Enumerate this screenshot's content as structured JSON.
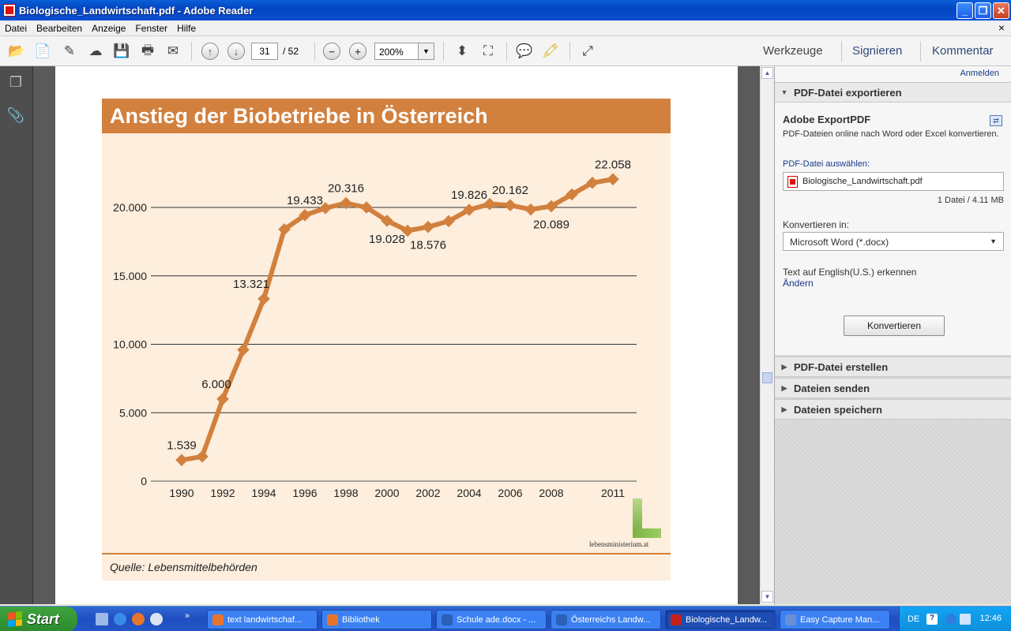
{
  "window": {
    "title": "Biologische_Landwirtschaft.pdf - Adobe Reader"
  },
  "menu": {
    "items": [
      "Datei",
      "Bearbeiten",
      "Anzeige",
      "Fenster",
      "Hilfe"
    ]
  },
  "toolbar": {
    "page_current": "31",
    "page_total": "/ 52",
    "zoom": "200%",
    "tools_label": "Werkzeuge",
    "sign_label": "Signieren",
    "comment_label": "Kommentar"
  },
  "document": {
    "chart_title": "Anstieg der Biobetriebe in Österreich",
    "source": "Quelle: Lebensmittelbehörden",
    "logo_text": "lebensministerium.at"
  },
  "chart_data": {
    "type": "line",
    "title": "Anstieg der Biobetriebe in Österreich",
    "xlabel": "",
    "ylabel": "",
    "ylim": [
      0,
      20000
    ],
    "yticks": [
      "0",
      "5.000",
      "10.000",
      "15.000",
      "20.000"
    ],
    "ytick_values": [
      0,
      5000,
      10000,
      15000,
      20000
    ],
    "xtick_labels": [
      "1990",
      "1992",
      "1994",
      "1996",
      "1998",
      "2000",
      "2002",
      "2004",
      "2006",
      "2008",
      "2011"
    ],
    "xtick_years": [
      1990,
      1992,
      1994,
      1996,
      1998,
      2000,
      2002,
      2004,
      2006,
      2008,
      2011
    ],
    "grid": true,
    "line_color": "#d2803d",
    "series": [
      {
        "x": [
          1990,
          1991,
          1992,
          1993,
          1994,
          1995,
          1996,
          1997,
          1998,
          1999,
          2000,
          2001,
          2002,
          2003,
          2004,
          2005,
          2006,
          2007,
          2008,
          2009,
          2010,
          2011
        ],
        "values": [
          1539,
          1800,
          6000,
          9600,
          13321,
          18400,
          19433,
          19950,
          20316,
          20000,
          19028,
          18300,
          18576,
          19000,
          19826,
          20250,
          20162,
          19850,
          20089,
          20950,
          21800,
          22058
        ]
      }
    ],
    "data_labels": [
      {
        "x": 1990,
        "text": "1.539"
      },
      {
        "x": 1992,
        "text": "6.000"
      },
      {
        "x": 1994,
        "text": "13.321"
      },
      {
        "x": 1996,
        "text": "19.433"
      },
      {
        "x": 1998,
        "text": "20.316"
      },
      {
        "x": 2000,
        "text": "19.028"
      },
      {
        "x": 2002,
        "text": "18.576"
      },
      {
        "x": 2004,
        "text": "19.826"
      },
      {
        "x": 2006,
        "text": "20.162"
      },
      {
        "x": 2008,
        "text": "20.089"
      },
      {
        "x": 2011,
        "text": "22.058"
      }
    ]
  },
  "right_panel": {
    "login": "Anmelden",
    "export_header": "PDF-Datei exportieren",
    "export_title": "Adobe ExportPDF",
    "export_subtitle": "PDF-Dateien online nach Word oder Excel konvertieren.",
    "pick_label": "PDF-Datei auswählen:",
    "file_name": "Biologische_Landwirtschaft.pdf",
    "file_info": "1 Datei / 4.11 MB",
    "convert_to_label": "Konvertieren in:",
    "convert_to_value": "Microsoft Word (*.docx)",
    "ocr_label": "Text auf English(U.S.) erkennen",
    "change_link": "Ändern",
    "convert_button": "Konvertieren",
    "sections": [
      "PDF-Datei erstellen",
      "Dateien senden",
      "Dateien speichern"
    ]
  },
  "taskbar": {
    "start_label": "Start",
    "tasks": [
      {
        "label": "text landwirtschaf...",
        "icon_color": "#e8742a"
      },
      {
        "label": "Bibliothek",
        "icon_color": "#e8742a"
      },
      {
        "label": "Schule ade.docx - ...",
        "icon_color": "#2b5fb8"
      },
      {
        "label": "Österreichs Landw...",
        "icon_color": "#2b5fb8"
      },
      {
        "label": "Biologische_Landw...",
        "icon_color": "#c8201a"
      },
      {
        "label": "Easy Capture Man...",
        "icon_color": "#6a8fd8"
      }
    ],
    "lang": "DE",
    "clock": "12:46"
  }
}
